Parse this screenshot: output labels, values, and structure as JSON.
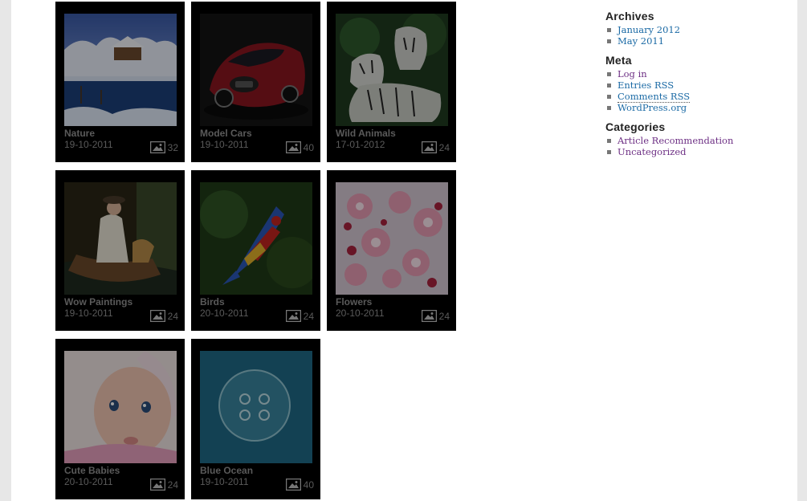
{
  "albums": [
    {
      "title": "Nature",
      "date": "19-10-2011",
      "count": "32",
      "thumb_icon": "winter-lake-photo"
    },
    {
      "title": "Model Cars",
      "date": "19-10-2011",
      "count": "40",
      "thumb_icon": "red-sports-car-photo"
    },
    {
      "title": "Wild Animals",
      "date": "17-01-2012",
      "count": "24",
      "thumb_icon": "white-tigers-photo"
    },
    {
      "title": "Wow Paintings",
      "date": "19-10-2011",
      "count": "24",
      "thumb_icon": "lady-in-boat-painting"
    },
    {
      "title": "Birds",
      "date": "20-10-2011",
      "count": "24",
      "thumb_icon": "macaw-photo"
    },
    {
      "title": "Flowers",
      "date": "20-10-2011",
      "count": "24",
      "thumb_icon": "cherry-blossom-photo"
    },
    {
      "title": "Cute Babies",
      "date": "20-10-2011",
      "count": "24",
      "thumb_icon": "baby-face-photo"
    },
    {
      "title": "Blue Ocean",
      "date": "19-10-2011",
      "count": "40",
      "thumb_icon": "jellyfish-photo"
    }
  ],
  "sidebar": {
    "archives": {
      "title": "Archives",
      "items": [
        "January 2012",
        "May 2011"
      ]
    },
    "meta": {
      "title": "Meta",
      "items": [
        "Log in",
        "Entries RSS",
        "Comments RSS",
        "WordPress.org"
      ]
    },
    "categories": {
      "title": "Categories",
      "items": [
        "Article Recommendation",
        "Uncategorized"
      ]
    }
  },
  "colors": {
    "link_blue": "#1b6aa5",
    "link_purple": "#6d2f84",
    "card_bg": "#000000",
    "caption_text": "#5a5a5a"
  }
}
